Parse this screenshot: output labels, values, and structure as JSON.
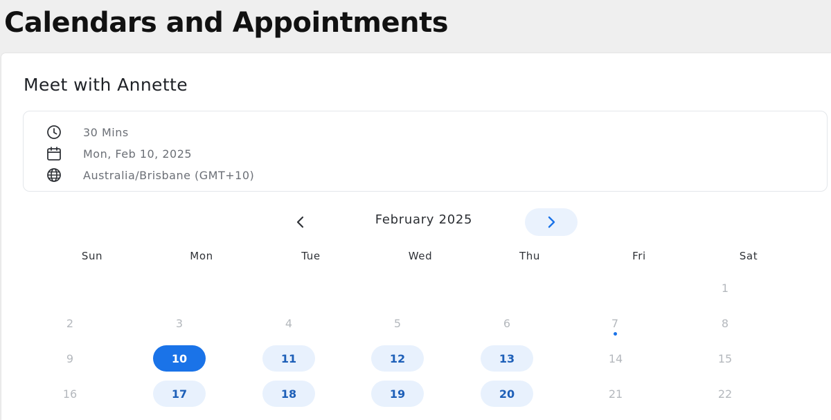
{
  "page": {
    "heading": "Calendars and Appointments"
  },
  "booking": {
    "title": "Meet with Annette",
    "duration": "30 Mins",
    "date": "Mon, Feb 10, 2025",
    "timezone": "Australia/Brisbane (GMT+10)"
  },
  "calendar": {
    "month_label": "February 2025",
    "weekdays": [
      "Sun",
      "Mon",
      "Tue",
      "Wed",
      "Thu",
      "Fri",
      "Sat"
    ],
    "days": {
      "d1": "1",
      "d2": "2",
      "d3": "3",
      "d4": "4",
      "d5": "5",
      "d6": "6",
      "d7": "7",
      "d8": "8",
      "d9": "9",
      "d10": "10",
      "d11": "11",
      "d12": "12",
      "d13": "13",
      "d14": "14",
      "d15": "15",
      "d16": "16",
      "d17": "17",
      "d18": "18",
      "d19": "19",
      "d20": "20",
      "d21": "21",
      "d22": "22"
    },
    "selected_day": "10",
    "available_days": [
      "11",
      "12",
      "13",
      "17",
      "18",
      "19",
      "20"
    ],
    "today_marker_day": "7"
  },
  "colors": {
    "accent": "#1a73e8",
    "available_bg": "#e8f1fd",
    "disabled_text": "#b4b8bd"
  },
  "icons": {
    "duration": "clock-icon",
    "date": "calendar-icon",
    "timezone": "globe-icon",
    "prev": "chevron-left-icon",
    "next": "chevron-right-icon"
  }
}
